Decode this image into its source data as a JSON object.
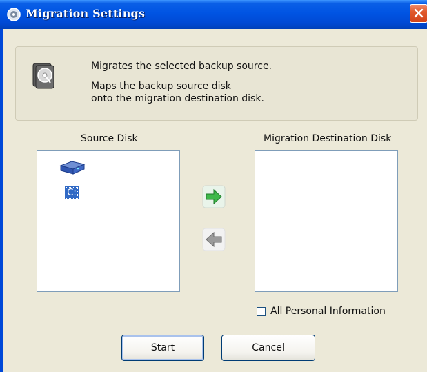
{
  "window": {
    "title": "Migration Settings"
  },
  "info": {
    "line1": "Migrates the selected backup source.",
    "line2": "Maps the backup source disk",
    "line3": "onto the migration destination disk."
  },
  "source": {
    "label": "Source Disk",
    "drive_letter": "C:"
  },
  "destination": {
    "label": "Migration Destination Disk"
  },
  "options": {
    "all_personal_info_label": "All Personal Information",
    "all_personal_info_checked": false
  },
  "buttons": {
    "start": "Start",
    "cancel": "Cancel"
  },
  "colors": {
    "title_bar": "#0054e3",
    "close_button": "#e05a2c",
    "selection": "#316ac5",
    "arrow_active": "#3fb84a",
    "arrow_inactive": "#9a9a9a"
  }
}
